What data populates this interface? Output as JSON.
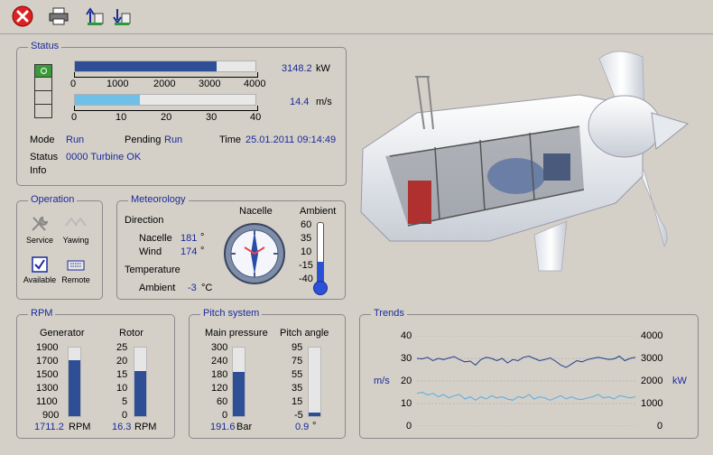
{
  "toolbar": {
    "close": "close-icon",
    "print": "printer-icon",
    "up": "upload-icon",
    "down": "download-icon"
  },
  "status": {
    "title": "Status",
    "power": {
      "value": 3148.2,
      "unit": "kW",
      "display": "3148.2",
      "max": 4000,
      "ticks": [
        "0",
        "1000",
        "2000",
        "3000",
        "4000"
      ]
    },
    "wind": {
      "value": 14.4,
      "unit": "m/s",
      "display": "14.4",
      "max": 40,
      "ticks": [
        "0",
        "10",
        "20",
        "30",
        "40"
      ]
    },
    "mode_label": "Mode",
    "mode_value": "Run",
    "pending_label": "Pending",
    "pending_value": "Run",
    "time_label": "Time",
    "time_value": "25.01.2011 09:14:49",
    "status_label": "Status",
    "status_value": "0000 Turbine OK",
    "info_label": "Info"
  },
  "operation": {
    "title": "Operation",
    "service": "Service",
    "yawing": "Yawing",
    "available": "Available",
    "remote": "Remote"
  },
  "meteorology": {
    "title": "Meteorology",
    "direction": "Direction",
    "nacelle_label": "Nacelle",
    "nacelle_value": "181",
    "wind_label": "Wind",
    "wind_value": "174",
    "deg": "°",
    "temperature": "Temperature",
    "ambient_label": "Ambient",
    "ambient_value": "-3",
    "temp_unit": "°C",
    "compass_title": "Nacelle",
    "thermo_title": "Ambient",
    "thermo_ticks": [
      "60",
      "35",
      "10",
      "-15",
      "-40"
    ],
    "thermo": {
      "min": -40,
      "max": 60,
      "value": -3
    }
  },
  "rpm": {
    "title": "RPM",
    "gen_title": "Generator",
    "rotor_title": "Rotor",
    "gen_ticks": [
      "1900",
      "1700",
      "1500",
      "1300",
      "1100",
      "900"
    ],
    "rotor_ticks": [
      "25",
      "20",
      "15",
      "10",
      "5",
      "0"
    ],
    "gen": {
      "value": 1711.2,
      "min": 900,
      "max": 1900,
      "display": "1711.2",
      "unit": "RPM"
    },
    "rotor": {
      "value": 16.3,
      "min": 0,
      "max": 25,
      "display": "16.3",
      "unit": "RPM"
    }
  },
  "pitch": {
    "title": "Pitch system",
    "pressure_title": "Main pressure",
    "angle_title": "Pitch angle",
    "pressure_ticks": [
      "300",
      "240",
      "180",
      "120",
      "60",
      "0"
    ],
    "angle_ticks": [
      "95",
      "75",
      "55",
      "35",
      "15",
      "-5"
    ],
    "pressure": {
      "value": 191.6,
      "min": 0,
      "max": 300,
      "display": "191.6",
      "unit": "Bar"
    },
    "angle": {
      "value": 0.9,
      "min": -5,
      "max": 95,
      "display": "0.9",
      "unit": "°"
    }
  },
  "chart_data": {
    "type": "line",
    "title": "Trends",
    "ylabel_left": "m/s",
    "ylabel_right": "kW",
    "ylim_left": [
      0,
      40
    ],
    "ylim_right": [
      0,
      4000
    ],
    "left_ticks": [
      "40",
      "30",
      "20",
      "10",
      "0"
    ],
    "right_ticks": [
      "4000",
      "3000",
      "2000",
      "1000",
      "0"
    ],
    "grid": true,
    "series": [
      {
        "axis": "right",
        "color": "#1f3c8c",
        "values": [
          3000,
          2980,
          3050,
          2900,
          3000,
          2950,
          3020,
          3080,
          2950,
          2850,
          2880,
          2700,
          2950,
          3050,
          3000,
          2900,
          3000,
          2800,
          2950,
          2900,
          3050,
          3100,
          3000,
          2900,
          2950,
          3020,
          2880,
          2700,
          2600,
          2750,
          2900,
          2850,
          2950,
          3000,
          3050,
          3000,
          2950,
          2980,
          3100,
          2900,
          3000,
          3050
        ]
      },
      {
        "axis": "left",
        "color": "#55aee0",
        "values": [
          14.5,
          15,
          13.8,
          14.5,
          13,
          14,
          12.5,
          13.5,
          14,
          12,
          13,
          11.5,
          13,
          12,
          13.5,
          12.5,
          13,
          12,
          11.5,
          13,
          12.5,
          14,
          12,
          13,
          12.5,
          11.5,
          12.5,
          13.5,
          12,
          13,
          12,
          11.8,
          12.5,
          13,
          14,
          12.5,
          13,
          12,
          13.5,
          13,
          12.5,
          13
        ]
      }
    ]
  }
}
